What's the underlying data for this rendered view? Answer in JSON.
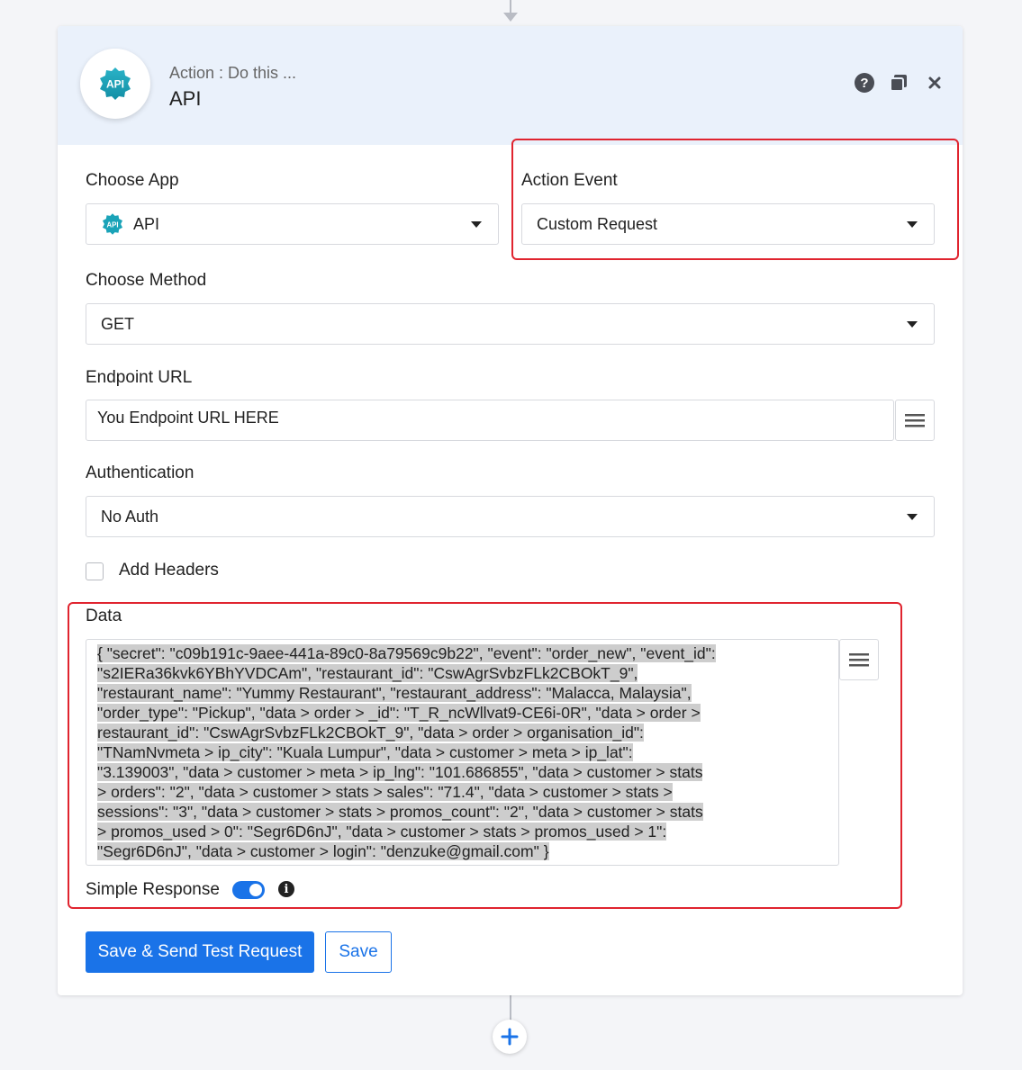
{
  "header": {
    "subtitle": "Action : Do this ...",
    "title": "API",
    "logo_text": "API"
  },
  "choose_app": {
    "label": "Choose App",
    "value": "API",
    "logo_text": "API"
  },
  "action_event": {
    "label": "Action Event",
    "value": "Custom Request"
  },
  "choose_method": {
    "label": "Choose Method",
    "value": "GET"
  },
  "endpoint": {
    "label": "Endpoint URL",
    "value": "You Endpoint URL HERE"
  },
  "authentication": {
    "label": "Authentication",
    "value": "No Auth"
  },
  "add_headers": {
    "label": "Add Headers",
    "checked": false
  },
  "data_field": {
    "label": "Data",
    "lines": [
      "{ \"secret\": \"c09b191c-9aee-441a-89c0-8a79569c9b22\", \"event\": \"order_new\", \"event_id\":",
      "\"s2IERa36kvk6YBhYVDCAm\", \"restaurant_id\": \"CswAgrSvbzFLk2CBOkT_9\",",
      "\"restaurant_name\": \"Yummy Restaurant\", \"restaurant_address\": \"Malacca, Malaysia\",",
      "\"order_type\": \"Pickup\", \"data > order > _id\": \"T_R_ncWllvat9-CE6i-0R\", \"data > order >",
      "restaurant_id\": \"CswAgrSvbzFLk2CBOkT_9\", \"data > order > organisation_id\":",
      "\"TNamNvmeta > ip_city\": \"Kuala Lumpur\", \"data > customer > meta > ip_lat\":",
      "\"3.139003\", \"data > customer > meta > ip_lng\": \"101.686855\", \"data > customer > stats",
      "> orders\": \"2\", \"data > customer > stats > sales\": \"71.4\", \"data > customer > stats >",
      "sessions\": \"3\", \"data > customer > stats > promos_count\": \"2\", \"data > customer > stats",
      "> promos_used > 0\": \"Segr6D6nJ\", \"data > customer > stats > promos_used > 1\":",
      "\"Segr6D6nJ\", \"data > customer > login\": \"denzuke@gmail.com\" }"
    ]
  },
  "simple_response": {
    "label": "Simple Response",
    "enabled": true
  },
  "buttons": {
    "save_send": "Save & Send Test Request",
    "save": "Save"
  },
  "colors": {
    "accent": "#1a73e8",
    "highlight": "#e0242f",
    "header_bg": "#eaf1fb",
    "logo_teal": "#1aa3b8"
  },
  "icons": [
    "help-icon",
    "copy-icon",
    "close-icon",
    "hamburger-icon",
    "chevron-down-icon",
    "info-icon",
    "plus-icon"
  ]
}
